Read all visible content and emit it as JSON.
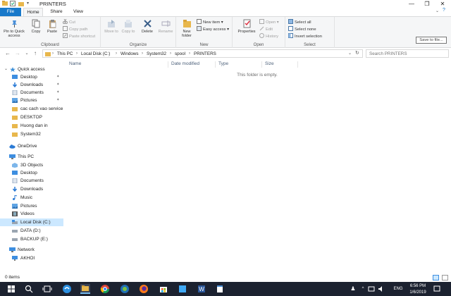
{
  "window": {
    "title": "PRINTERS",
    "controls": {
      "minimize": "—",
      "maximize": "❐",
      "close": "✕"
    }
  },
  "tabs": [
    {
      "label": "File"
    },
    {
      "label": "Home"
    },
    {
      "label": "Share"
    },
    {
      "label": "View"
    }
  ],
  "ribbon": {
    "clipboard": {
      "label": "Clipboard",
      "pin": "Pin to Quick access",
      "copy": "Copy",
      "paste": "Paste",
      "cut": "Cut",
      "copy_path": "Copy path",
      "paste_shortcut": "Paste shortcut"
    },
    "organize": {
      "label": "Organize",
      "move_to": "Move to",
      "copy_to": "Copy to",
      "delete": "Delete",
      "rename": "Rename"
    },
    "new": {
      "label": "New",
      "new_folder": "New folder",
      "new_item": "New item",
      "easy_access": "Easy access"
    },
    "open": {
      "label": "Open",
      "properties": "Properties",
      "open": "Open",
      "edit": "Edit",
      "history": "History"
    },
    "select": {
      "label": "Select",
      "select_all": "Select all",
      "select_none": "Select none",
      "invert_selection": "Invert selection"
    }
  },
  "tooltip": "Save to file...",
  "address": {
    "breadcrumbs": [
      "This PC",
      "Local Disk (C:)",
      "Windows",
      "System32",
      "spool",
      "PRINTERS"
    ]
  },
  "search": {
    "placeholder": "Search PRINTERS"
  },
  "navpane": {
    "quick_access": "Quick access",
    "quick_items": [
      "Desktop",
      "Downloads",
      "Documents",
      "Pictures",
      "cac cach vao service",
      "DESKTOP",
      "Huong dan in",
      "System32"
    ],
    "onedrive": "OneDrive",
    "this_pc": "This PC",
    "pc_items": [
      "3D Objects",
      "Desktop",
      "Documents",
      "Downloads",
      "Music",
      "Pictures",
      "Videos",
      "Local Disk (C:)",
      "DATA (D:)",
      "BACKUP (E:)"
    ],
    "network": "Network",
    "network_items": [
      "AKHOI"
    ]
  },
  "columns": [
    "Name",
    "Date modified",
    "Type",
    "Size"
  ],
  "empty_message": "This folder is empty.",
  "status": {
    "items": "0 items"
  },
  "taskbar": {
    "language": "ENG",
    "time": "6:56 PM",
    "date": "1/6/2019"
  },
  "colors": {
    "accent": "#1979ca",
    "selection": "#cce8ff",
    "taskbar": "#1c2230",
    "folder": "#e8b74c"
  }
}
